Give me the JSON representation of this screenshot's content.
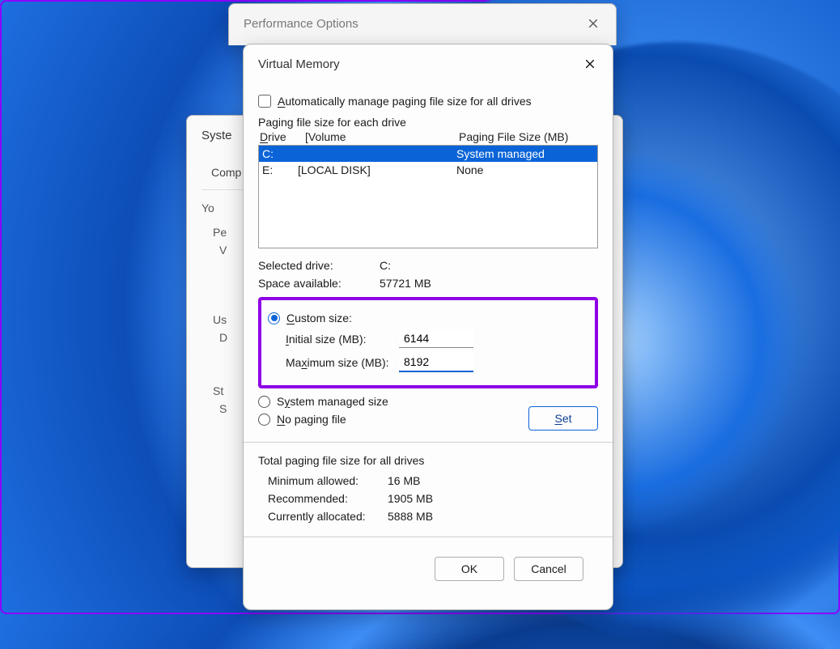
{
  "perf_window": {
    "title": "Performance Options"
  },
  "sys_window": {
    "title": "Syste",
    "tab": "Comp",
    "lines": [
      "Yo",
      "Pe",
      "V",
      "Us",
      "D",
      "St",
      "S"
    ]
  },
  "vm_window": {
    "title": "Virtual Memory",
    "auto_manage_label_pre": "A",
    "auto_manage_label_rest": "utomatically manage paging file size for all drives",
    "paging_each_drive": "Paging file size for each drive",
    "headers": {
      "drive_u": "D",
      "drive_rest": "rive",
      "volume": "[Volume",
      "pfs": "Paging File Size (MB)"
    },
    "drives": [
      {
        "letter": "C:",
        "volume": "",
        "size": "System managed",
        "selected": true
      },
      {
        "letter": "E:",
        "volume": "[LOCAL DISK]",
        "size": "None",
        "selected": false
      }
    ],
    "selected_drive_label": "Selected drive:",
    "selected_drive_value": "C:",
    "space_avail_label": "Space available:",
    "space_avail_value": "57721 MB",
    "custom_size_u": "C",
    "custom_size_rest": "ustom size:",
    "initial_u": "I",
    "initial_rest": "nitial size (MB):",
    "initial_value": "6144",
    "max_u_pre": "Ma",
    "max_u": "x",
    "max_rest": "imum size (MB):",
    "max_value": "8192",
    "sys_managed_u": "y",
    "sys_managed_pre": "S",
    "sys_managed_rest": "stem managed size",
    "no_paging_u": "N",
    "no_paging_rest": "o paging file",
    "set_btn_u": "S",
    "set_btn_rest": "et",
    "totals_title": "Total paging file size for all drives",
    "totals": {
      "min_label": "Minimum allowed:",
      "min_value": "16 MB",
      "rec_label": "Recommended:",
      "rec_value": "1905 MB",
      "cur_label": "Currently allocated:",
      "cur_value": "5888 MB"
    },
    "ok": "OK",
    "cancel": "Cancel"
  }
}
